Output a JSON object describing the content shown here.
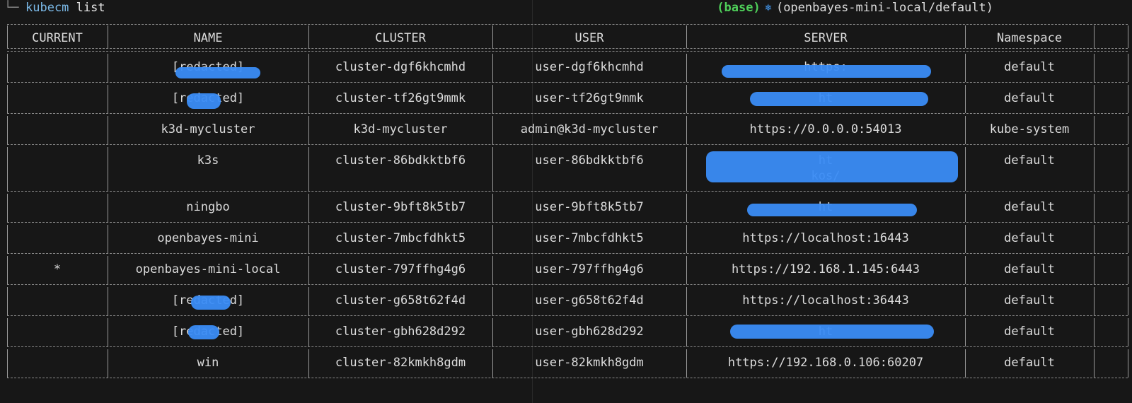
{
  "terminal": {
    "tree_glyph": "└─",
    "command_program": "kubecm",
    "command_arg": "list",
    "env": "(base)",
    "k8s_icon": "⎈",
    "context": "(openbayes-mini-local/default)"
  },
  "table": {
    "headers": [
      "CURRENT",
      "NAME",
      "CLUSTER",
      "USER",
      "SERVER",
      "Namespace"
    ],
    "rows": [
      {
        "current": "",
        "name": "[redacted]",
        "cluster": "cluster-dgf6khcmhd",
        "user": "user-dgf6khcmhd",
        "server": "https:",
        "namespace": "default"
      },
      {
        "current": "",
        "name": "[redacted]",
        "cluster": "cluster-tf26gt9mmk",
        "user": "user-tf26gt9mmk",
        "server": "ht",
        "namespace": "default"
      },
      {
        "current": "",
        "name": "k3d-mycluster",
        "cluster": "k3d-mycluster",
        "user": "admin@k3d-mycluster",
        "server": "https://0.0.0.0:54013",
        "namespace": "kube-system"
      },
      {
        "current": "",
        "name": "k3s",
        "cluster": "cluster-86bdkktbf6",
        "user": "user-86bdkktbf6",
        "server": "ht",
        "server_line2": "kos/",
        "namespace": "default"
      },
      {
        "current": "",
        "name": "ningbo",
        "cluster": "cluster-9bft8k5tb7",
        "user": "user-9bft8k5tb7",
        "server": "ht",
        "namespace": "default"
      },
      {
        "current": "",
        "name": "openbayes-mini",
        "cluster": "cluster-7mbcfdhkt5",
        "user": "user-7mbcfdhkt5",
        "server": "https://localhost:16443",
        "namespace": "default"
      },
      {
        "current": "*",
        "name": "openbayes-mini-local",
        "cluster": "cluster-797ffhg4g6",
        "user": "user-797ffhg4g6",
        "server": "https://192.168.1.145:6443",
        "namespace": "default"
      },
      {
        "current": "",
        "name": "[redacted]",
        "cluster": "cluster-g658t62f4d",
        "user": "user-g658t62f4d",
        "server": "https://localhost:36443",
        "namespace": "default"
      },
      {
        "current": "",
        "name": "[redacted]",
        "cluster": "cluster-gbh628d292",
        "user": "user-gbh628d292",
        "server": "ht",
        "namespace": "default"
      },
      {
        "current": "",
        "name": "win",
        "cluster": "cluster-82kmkh8gdm",
        "user": "user-82kmkh8gdm",
        "server": "https://192.168.0.106:60207",
        "namespace": "default"
      }
    ]
  },
  "colors": {
    "background": "#171717",
    "command": "#7ab8e6",
    "env": "#4fd15a",
    "k8s_icon": "#3f8fe0",
    "redaction": "#3a8cf5"
  }
}
